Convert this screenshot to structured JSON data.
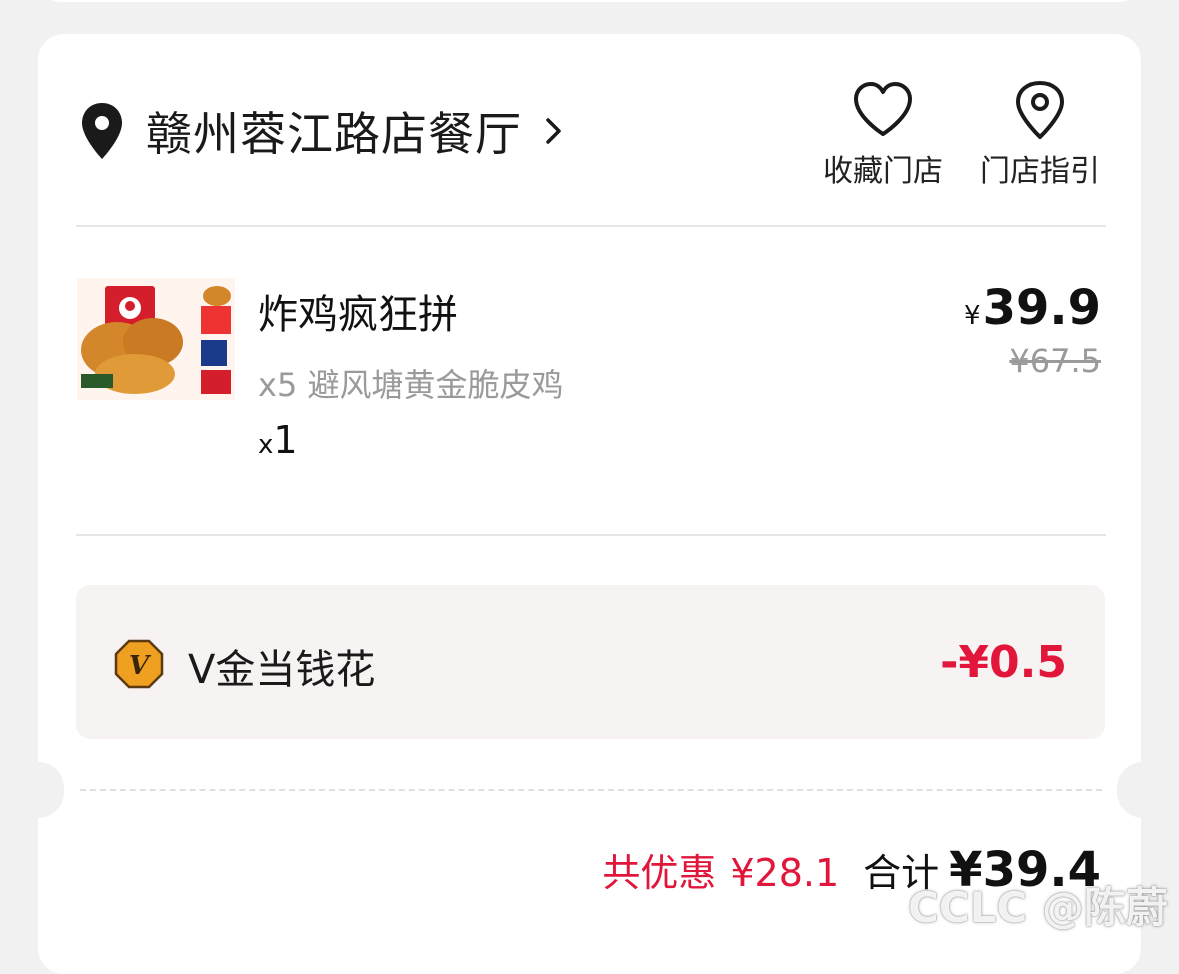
{
  "store": {
    "name": "赣州蓉江路店餐厅",
    "location_icon": "location-pin-icon",
    "chevron_icon": "chevron-right-icon"
  },
  "actions": {
    "favorite": {
      "label": "收藏门店",
      "icon": "heart-outline-icon"
    },
    "guide": {
      "label": "门店指引",
      "icon": "map-pin-outline-icon"
    }
  },
  "order_item": {
    "name": "炸鸡疯狂拼",
    "description": "x5 避风塘黄金脆皮鸡",
    "qty_prefix": "x",
    "qty": "1",
    "currency": "¥",
    "price": "39.9",
    "original_price": "¥67.5"
  },
  "discount": {
    "label": "V金当钱花",
    "amount": "-¥0.5",
    "icon": "v-gold-coin-icon"
  },
  "summary": {
    "saved_label": "共优惠",
    "saved_amount": "¥28.1",
    "total_label": "合计",
    "total_amount": "¥39.4"
  },
  "watermark": "CCLC @陈蔚",
  "colors": {
    "accent_red": "#e1163a",
    "gold": "#f0a020",
    "muted_text": "#9a9a9a",
    "page_bg": "#f1f1f1",
    "discount_bg": "#f7f3f2"
  }
}
